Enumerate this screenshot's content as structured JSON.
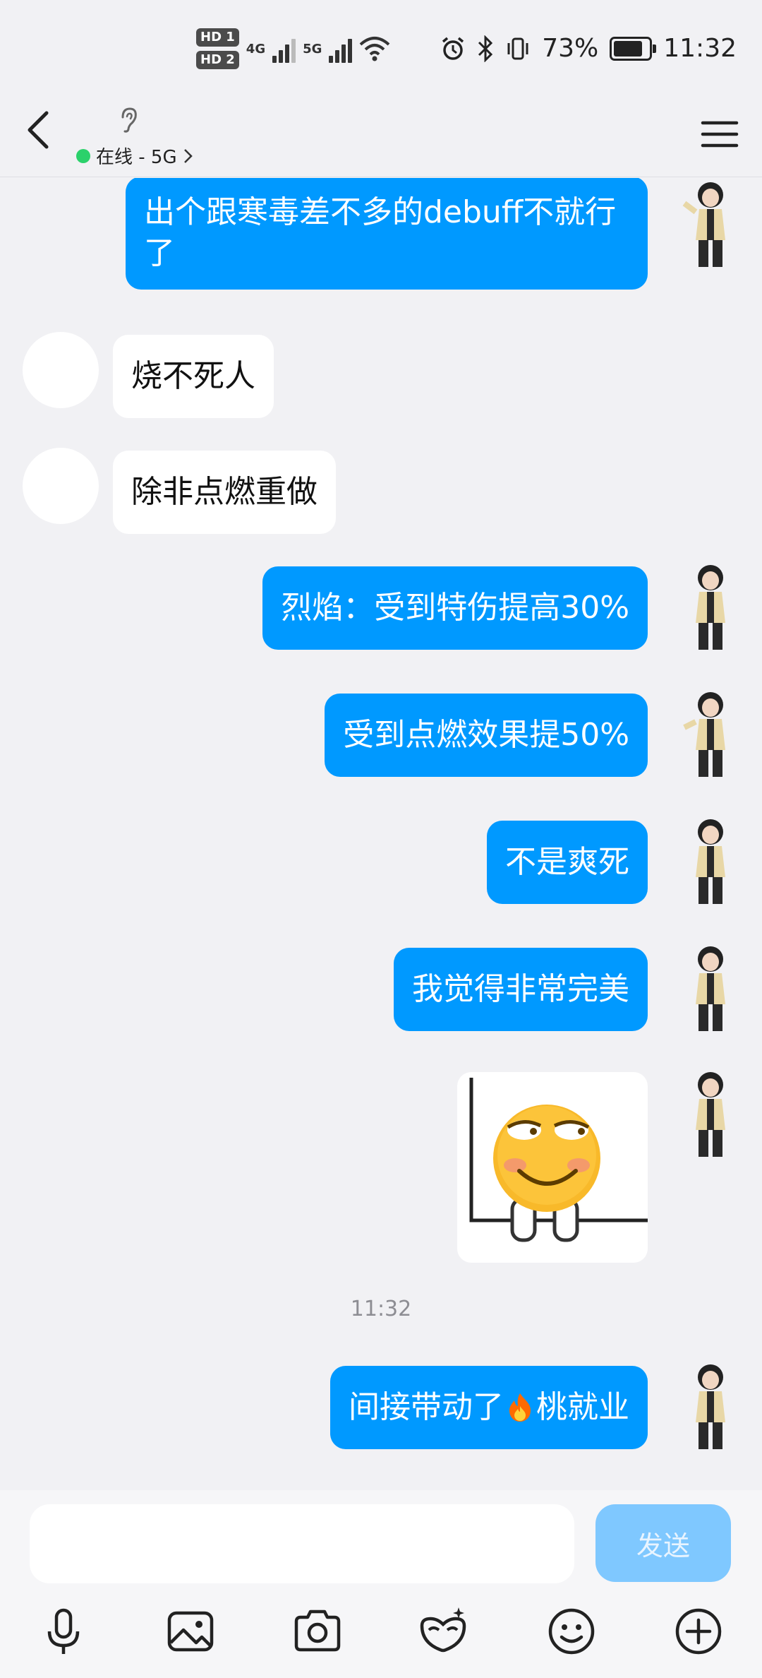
{
  "status_bar": {
    "hd1": "HD 1",
    "hd2": "HD 2",
    "net1": "4G",
    "net2": "5G",
    "battery_text": "73%",
    "battery_level": 0.73,
    "time": "11:32"
  },
  "header": {
    "status": "在线 - 5G",
    "status_color": "#2bd16b"
  },
  "messages": [
    {
      "from": "me",
      "text": "出个跟寒毒差不多的debuff不就行了"
    },
    {
      "from": "them",
      "text": "烧不死人"
    },
    {
      "from": "them",
      "text": "除非点燃重做"
    },
    {
      "from": "me",
      "text": "烈焰：受到特伤提高30%"
    },
    {
      "from": "me",
      "text": "受到点燃效果提50%"
    },
    {
      "from": "me",
      "text": "不是爽死"
    },
    {
      "from": "me",
      "text": "我觉得非常完美"
    },
    {
      "from": "me",
      "type": "sticker",
      "sticker": "smirking-emoji-sticker"
    },
    {
      "timestamp": "11:32"
    },
    {
      "from": "me",
      "text_before": "间接带动了",
      "emoji": "fire-emoji",
      "text_after": "桃就业"
    }
  ],
  "input": {
    "placeholder": "",
    "send_label": "发送"
  },
  "toolbar": [
    "microphone-icon",
    "image-icon",
    "camera-icon",
    "redpacket-mask-icon",
    "emoji-icon",
    "plus-icon"
  ],
  "colors": {
    "my_bubble": "#0099ff",
    "their_bubble": "#ffffff",
    "background": "#f1f1f4",
    "send_button": "#7fc8ff"
  }
}
